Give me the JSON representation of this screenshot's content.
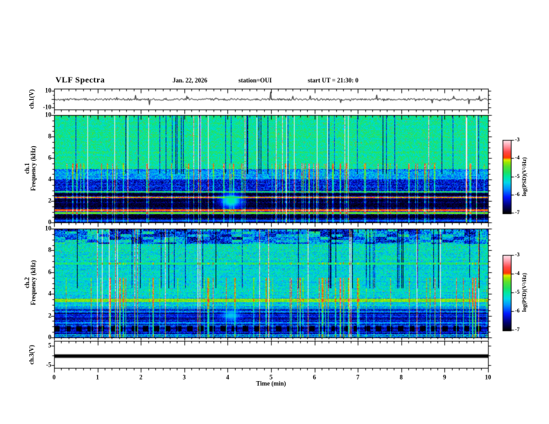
{
  "header": {
    "title": "VLF Spectra",
    "date": "Jan. 22, 2026",
    "station": "station=OUI",
    "start_ut": "start UT =  21:30: 0"
  },
  "axes": {
    "time_label": "Time (min)",
    "time_ticks": [
      0,
      1,
      2,
      3,
      4,
      5,
      6,
      7,
      8,
      9,
      10
    ],
    "freq_ticks": [
      0,
      2,
      4,
      6,
      8,
      10
    ]
  },
  "panels": {
    "ch1_voltage": {
      "label": "ch.1(V)",
      "ymax": "10",
      "ymin": "-10"
    },
    "ch1_spectrogram": {
      "label_line1": "ch.1",
      "label_line2": "Frequency (kHz)"
    },
    "ch2_spectrogram": {
      "label_line1": "ch.2",
      "label_line2": "Frequency (kHz)"
    },
    "ch3_voltage": {
      "label": "ch.3(V)",
      "ymax": "5",
      "ymin": "-5"
    }
  },
  "colorbar": {
    "label": "log(PSD)(V²/Hz)",
    "ticks": [
      "-3",
      "-4",
      "-5",
      "-6",
      "-7"
    ],
    "zlim": [
      -7,
      -3
    ],
    "stops": [
      [
        0.0,
        "#000004"
      ],
      [
        0.1,
        "#00006e"
      ],
      [
        0.22,
        "#0018ff"
      ],
      [
        0.33,
        "#0090ff"
      ],
      [
        0.42,
        "#00d8e8"
      ],
      [
        0.5,
        "#00e8a0"
      ],
      [
        0.56,
        "#20e060"
      ],
      [
        0.64,
        "#58e030"
      ],
      [
        0.7,
        "#a0e800"
      ],
      [
        0.73,
        "#e0f000"
      ],
      [
        0.76,
        "#ff3800"
      ],
      [
        0.84,
        "#ff4848"
      ],
      [
        0.92,
        "#ff9aa8"
      ],
      [
        1.0,
        "#ffe8ee"
      ]
    ]
  },
  "colors": {
    "background": "#ffffff",
    "axis": "#000000",
    "trace": "#000000"
  },
  "chart_data": [
    {
      "type": "line",
      "panel": "ch1_voltage",
      "xlabel": "Time (min)",
      "xlim": [
        0,
        10
      ],
      "ylim": [
        -10,
        10
      ],
      "baseline": 0,
      "noise_amp": 1.1,
      "spikes": [
        {
          "t": 1.87,
          "a": 5
        },
        {
          "t": 2.19,
          "a": -6.5
        },
        {
          "t": 3.05,
          "a": 4
        },
        {
          "t": 4.98,
          "a": 9
        },
        {
          "t": 5.5,
          "a": 4
        },
        {
          "t": 5.89,
          "a": 4.5
        },
        {
          "t": 6.6,
          "a": -4
        },
        {
          "t": 7.43,
          "a": 5.5
        },
        {
          "t": 8.7,
          "a": -4.5
        },
        {
          "t": 9.2,
          "a": 4
        },
        {
          "t": 9.55,
          "a": -5.5
        },
        {
          "t": 9.8,
          "a": 4
        }
      ]
    },
    {
      "type": "heatmap",
      "panel": "ch1_spectrogram",
      "xlim": [
        0,
        10
      ],
      "ylim": [
        0,
        10
      ],
      "zlim": [
        -7,
        -3
      ],
      "stripe_below": 3.0,
      "bands": [
        {
          "f": [
            5.0,
            10.0
          ],
          "level": -4.95,
          "noise": 0.38,
          "hot": 0.004
        },
        {
          "f": [
            4.0,
            5.0
          ],
          "level": -5.6,
          "noise": 0.5
        },
        {
          "f": [
            2.9,
            4.0
          ],
          "level": -6.2,
          "noise": 0.5
        },
        {
          "f": [
            0.0,
            2.9
          ],
          "level": -6.65,
          "noise": 0.4
        }
      ],
      "hlines": [
        {
          "f": 2.84,
          "hw": 0.07,
          "level": -4.8
        },
        {
          "f": 2.6,
          "hw": 0.08,
          "level": -6.95
        },
        {
          "f": 2.32,
          "hw": 0.07,
          "level": -4.0
        },
        {
          "f": 2.05,
          "hw": 0.1,
          "level": -6.9
        },
        {
          "f": 1.55,
          "hw": 0.25,
          "level": -6.85
        },
        {
          "f": 1.1,
          "hw": 0.07,
          "level": -3.85
        },
        {
          "f": 0.84,
          "hw": 0.07,
          "level": -4.45
        },
        {
          "f": 0.5,
          "hw": 0.12,
          "level": -6.9
        },
        {
          "f": 0.15,
          "hw": 0.1,
          "level": -5.9
        }
      ],
      "streaks": {
        "bright": 70,
        "dark": 28,
        "full": 22
      },
      "blobs": [
        {
          "t": 4.07,
          "f": 2.0,
          "rt": 0.25,
          "rf": 0.7,
          "level": -5.0
        }
      ]
    },
    {
      "type": "heatmap",
      "panel": "ch2_spectrogram",
      "xlim": [
        0,
        10
      ],
      "ylim": [
        0,
        10
      ],
      "zlim": [
        -7,
        -3
      ],
      "stripe_below": 3.0,
      "bands": [
        {
          "f": [
            8.6,
            10.0
          ],
          "level": -5.7,
          "noise": 0.65,
          "blocky": true
        },
        {
          "f": [
            7.0,
            8.6
          ],
          "level": -5.15,
          "noise": 0.5,
          "hot": 0.003
        },
        {
          "f": [
            3.6,
            7.0
          ],
          "level": -5.25,
          "noise": 0.42,
          "hot": 0.002
        },
        {
          "f": [
            2.6,
            3.6
          ],
          "level": -5.45,
          "noise": 0.4
        },
        {
          "f": [
            2.2,
            2.6
          ],
          "level": -5.95,
          "noise": 0.4
        },
        {
          "f": [
            1.5,
            2.2
          ],
          "level": -6.45,
          "noise": 0.35
        },
        {
          "f": [
            1.05,
            1.5
          ],
          "level": -6.1,
          "noise": 0.4
        },
        {
          "f": [
            0.55,
            1.05
          ],
          "level": -6.8,
          "noise": 0.3,
          "dash": true
        },
        {
          "f": [
            0.25,
            0.55
          ],
          "level": -6.3,
          "noise": 0.4
        },
        {
          "f": [
            0.0,
            0.25
          ],
          "level": -5.6,
          "noise": 0.6
        }
      ],
      "hlines": [
        {
          "f": 3.4,
          "hw": 0.14,
          "level": -4.35
        },
        {
          "f": 6.8,
          "hw": 0.07,
          "level": -4.85
        },
        {
          "f": 1.28,
          "hw": 0.06,
          "level": -5.7
        }
      ],
      "streaks": {
        "bright": 55,
        "dark": 30,
        "full": 18
      },
      "blobs": [
        {
          "t": 4.07,
          "f": 2.0,
          "rt": 0.2,
          "rf": 0.5,
          "level": -5.4
        }
      ]
    },
    {
      "type": "line",
      "panel": "ch3_voltage",
      "xlabel": "Time (min)",
      "xlim": [
        0,
        10
      ],
      "ylim": [
        -5,
        5
      ],
      "baseline": 0,
      "noise_amp": 0,
      "thickness_px": 5,
      "spikes": []
    }
  ]
}
